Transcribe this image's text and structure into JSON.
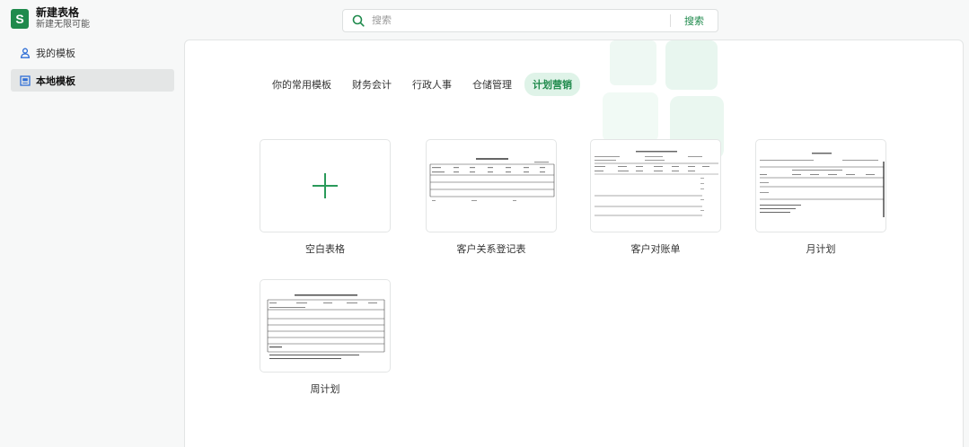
{
  "app": {
    "logo_letter": "S",
    "title": "新建表格",
    "subtitle": "新建无限可能"
  },
  "search": {
    "placeholder": "搜索",
    "button_label": "搜索"
  },
  "sidebar": {
    "items": [
      {
        "label": "我的模板",
        "icon": "user-icon",
        "active": false
      },
      {
        "label": "本地模板",
        "icon": "template-icon",
        "active": true
      }
    ]
  },
  "tabs": [
    {
      "label": "你的常用模板",
      "active": false
    },
    {
      "label": "财务会计",
      "active": false
    },
    {
      "label": "行政人事",
      "active": false
    },
    {
      "label": "仓储管理",
      "active": false
    },
    {
      "label": "计划营销",
      "active": true
    }
  ],
  "templates": [
    {
      "label": "空白表格",
      "kind": "blank"
    },
    {
      "label": "客户关系登记表",
      "kind": "preview"
    },
    {
      "label": "客户对账单",
      "kind": "preview"
    },
    {
      "label": "月计划",
      "kind": "preview"
    },
    {
      "label": "周计划",
      "kind": "preview"
    }
  ],
  "colors": {
    "accent": "#1f8a4c",
    "active_tab_bg": "#dff3e8"
  }
}
